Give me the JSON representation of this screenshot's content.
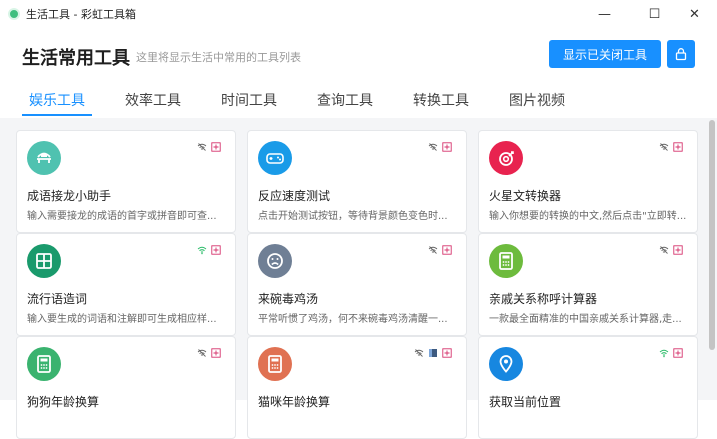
{
  "window": {
    "title": "生活工具 - 彩虹工具箱",
    "min_symbol": "—",
    "max_symbol": "☐",
    "close_symbol": "✕"
  },
  "header": {
    "title": "生活常用工具",
    "subtitle": "这里将显示生活中常用的工具列表",
    "show_closed_button": "显示已关闭工具",
    "lock_icon": "lock-icon"
  },
  "tabs": [
    {
      "label": "娱乐工具",
      "active": true
    },
    {
      "label": "效率工具",
      "active": false
    },
    {
      "label": "时间工具",
      "active": false
    },
    {
      "label": "查询工具",
      "active": false
    },
    {
      "label": "转换工具",
      "active": false
    },
    {
      "label": "图片视频",
      "active": false
    }
  ],
  "cards": [
    {
      "title": "成语接龙小助手",
      "desc": "输入需要接龙的成语的首字或拼音即可查...",
      "icon": "bridge-icon",
      "color": "#4fc2b0",
      "network": "offline"
    },
    {
      "title": "反应速度测试",
      "desc": "点击开始测试按钮，等待背景颜色变色时...",
      "icon": "gamepad-icon",
      "color": "#1a9be8",
      "network": "offline"
    },
    {
      "title": "火星文转换器",
      "desc": "输入你想要的转换的中文,然后点击\"立即转...",
      "icon": "target-icon",
      "color": "#e8234f",
      "network": "offline"
    },
    {
      "title": "流行语造词",
      "desc": "输入要生成的词语和注解即可生成相应样...",
      "icon": "grid-icon",
      "color": "#1a9a6c",
      "network": "online"
    },
    {
      "title": "来碗毒鸡汤",
      "desc": "平常听惯了鸡汤，何不来碗毒鸡汤清醒一...",
      "icon": "sad-face-icon",
      "color": "#6f7f95",
      "network": "offline"
    },
    {
      "title": "亲戚关系称呼计算器",
      "desc": "一款最全面精准的中国亲戚关系计算器,走...",
      "icon": "calculator-icon",
      "color": "#6dbb3d",
      "network": "offline"
    },
    {
      "title": "狗狗年龄换算",
      "desc": "",
      "icon": "calculator-icon",
      "color": "#3ab36f",
      "network": "offline"
    },
    {
      "title": "猫咪年龄换算",
      "desc": "",
      "icon": "calculator-icon",
      "color": "#e07152",
      "network": "offline-doc"
    },
    {
      "title": "获取当前位置",
      "desc": "",
      "icon": "location-pin-icon",
      "color": "#1787e0",
      "network": "online"
    }
  ]
}
